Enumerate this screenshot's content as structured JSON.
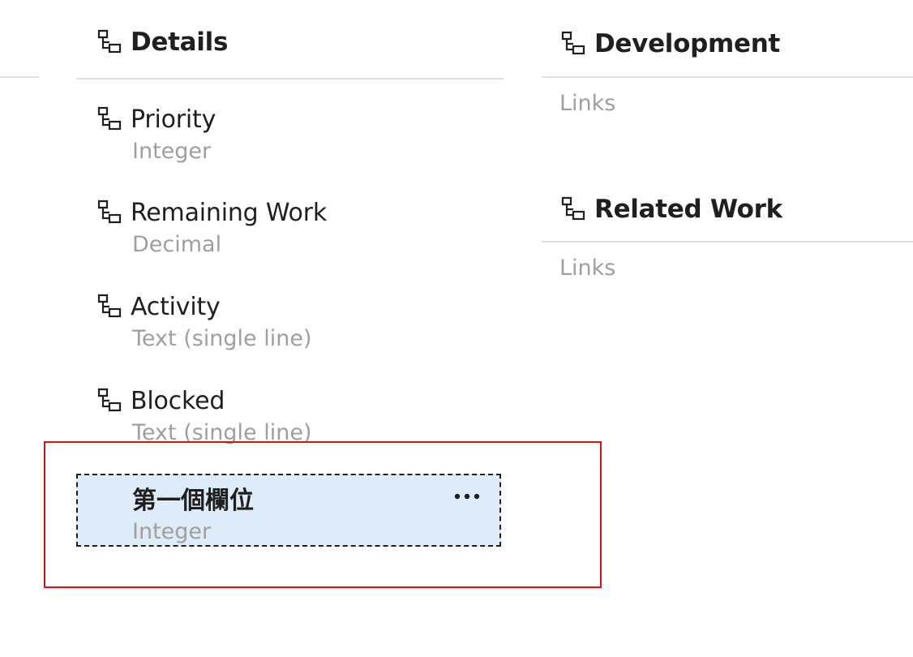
{
  "left_column": {
    "group_title": "Details",
    "fields": [
      {
        "name": "Priority",
        "type": "Integer"
      },
      {
        "name": "Remaining Work",
        "type": "Decimal"
      },
      {
        "name": "Activity",
        "type": "Text (single line)"
      },
      {
        "name": "Blocked",
        "type": "Text (single line)"
      }
    ],
    "selected_field": {
      "name": "第一個欄位",
      "type": "Integer",
      "more_icon": "more-horizontal-icon"
    }
  },
  "right_column": {
    "groups": [
      {
        "title": "Development",
        "content": "Links"
      },
      {
        "title": "Related Work",
        "content": "Links"
      }
    ]
  },
  "icons": {
    "group_icon": "layout-group-icon",
    "field_icon": "layout-field-icon"
  },
  "colors": {
    "selection_background": "#deecf9",
    "highlight_border": "#d0141c",
    "secondary_text": "#a19f9d"
  }
}
